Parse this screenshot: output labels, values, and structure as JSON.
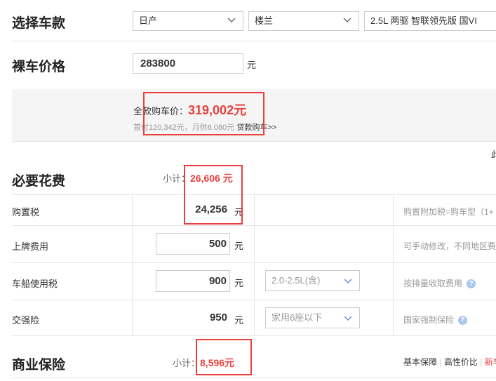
{
  "car_select": {
    "title": "选择车款",
    "brand": "日产",
    "model": "楼兰",
    "trim": "2.5L 两驱 智联领先版 国VI"
  },
  "bare_price": {
    "title": "裸车价格",
    "value": "283800",
    "unit": "元"
  },
  "summary": {
    "total_label": "全款购车价：",
    "total_value": "319,002元",
    "loan_info": "首付120,342元，月供6,080元",
    "loan_link": "贷款购车>>",
    "edge_text": "此"
  },
  "required_fees": {
    "title": "必要花费",
    "subtotal_label": "小计：",
    "subtotal_value": "26,606 元",
    "rows": [
      {
        "label": "购置税",
        "value": "24,256",
        "unit": "元",
        "note": "购置附加税=购车型（1+"
      },
      {
        "label": "上牌费用",
        "value": "500",
        "unit": "元",
        "note": "可手动修改，不同地区费"
      },
      {
        "label": "车船使用税",
        "value": "900",
        "unit": "元",
        "select": "2.0-2.5L(含)",
        "note": "按排量收取费用"
      },
      {
        "label": "交强险",
        "value": "950",
        "unit": "元",
        "select": "家用6座以下",
        "note": "国家强制保险"
      }
    ]
  },
  "commercial_insurance": {
    "title": "商业保险",
    "subtotal_label": "小计：",
    "subtotal_value": "8,596元",
    "options": [
      "基本保障",
      "高性价比",
      "新车"
    ]
  },
  "colors": {
    "accent_red": "#e8413d",
    "help_blue": "#a9c6ee"
  }
}
